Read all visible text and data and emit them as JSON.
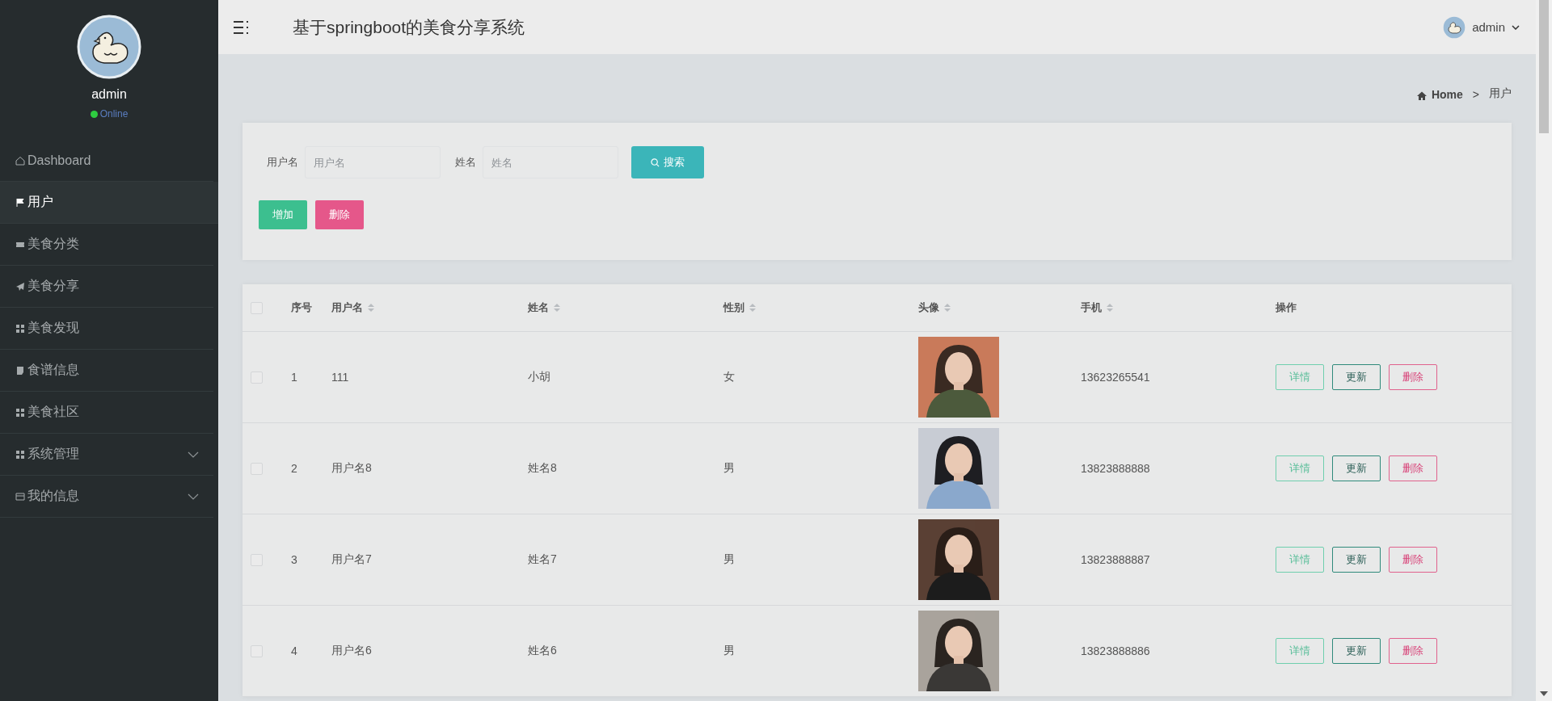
{
  "sidebar": {
    "user": {
      "name": "admin",
      "status": "Online",
      "online": true
    },
    "items": [
      {
        "label": "Dashboard",
        "kind": "link",
        "selected": false
      },
      {
        "label": "用户",
        "kind": "link",
        "selected": true
      },
      {
        "label": "美食分类",
        "kind": "link",
        "selected": false
      },
      {
        "label": "美食分享",
        "kind": "link",
        "selected": false
      },
      {
        "label": "美食发现",
        "kind": "link",
        "selected": false
      },
      {
        "label": "食谱信息",
        "kind": "link",
        "selected": false
      },
      {
        "label": "美食社区",
        "kind": "link",
        "selected": false
      },
      {
        "label": "系统管理",
        "kind": "group",
        "selected": false
      },
      {
        "label": "我的信息",
        "kind": "group",
        "selected": false
      }
    ]
  },
  "header": {
    "title": "基于springboot的美食分享系统",
    "user": "admin"
  },
  "breadcrumb": [
    "Home",
    ">",
    "用户"
  ],
  "search": {
    "fields": [
      {
        "label": "用户名",
        "placeholder": "用户名"
      },
      {
        "label": "姓名",
        "placeholder": "姓名"
      }
    ],
    "button": "搜索"
  },
  "actions": [
    {
      "label": "增加",
      "kind": "add"
    },
    {
      "label": "删除",
      "kind": "delete"
    }
  ],
  "table": {
    "select_all": {
      "checked": false
    },
    "columns": [
      {
        "label": "序号",
        "sortable": false
      },
      {
        "label": "用户名",
        "sortable": true
      },
      {
        "label": "姓名",
        "sortable": true
      },
      {
        "label": "性别",
        "sortable": true
      },
      {
        "label": "头像",
        "sortable": true
      },
      {
        "label": "手机",
        "sortable": true
      },
      {
        "label": "操作",
        "sortable": false
      }
    ],
    "rows": [
      {
        "checked": false,
        "index": "1",
        "username": "111",
        "name": "小胡",
        "gender": "女",
        "avatar": {
          "kind": "picture"
        },
        "phone": "13623265541",
        "buttons": [
          {
            "label": "详情",
            "kind": "detail"
          },
          {
            "label": "更新",
            "kind": "update"
          },
          {
            "label": "删除",
            "kind": "delete"
          }
        ]
      },
      {
        "checked": false,
        "index": "2",
        "username": "用户名8",
        "name": "姓名8",
        "gender": "男",
        "avatar": {
          "kind": "picture"
        },
        "phone": "13823888888",
        "buttons": [
          {
            "label": "详情",
            "kind": "detail"
          },
          {
            "label": "更新",
            "kind": "update"
          },
          {
            "label": "删除",
            "kind": "delete"
          }
        ]
      },
      {
        "checked": false,
        "index": "3",
        "username": "用户名7",
        "name": "姓名7",
        "gender": "男",
        "avatar": {
          "kind": "picture"
        },
        "phone": "13823888887",
        "buttons": [
          {
            "label": "详情",
            "kind": "detail"
          },
          {
            "label": "更新",
            "kind": "update"
          },
          {
            "label": "删除",
            "kind": "delete"
          }
        ]
      },
      {
        "checked": false,
        "index": "4",
        "username": "用户名6",
        "name": "姓名6",
        "gender": "男",
        "avatar": {
          "kind": "picture"
        },
        "phone": "13823888886",
        "buttons": [
          {
            "label": "详情",
            "kind": "detail"
          },
          {
            "label": "更新",
            "kind": "update"
          },
          {
            "label": "删除",
            "kind": "delete"
          }
        ]
      }
    ]
  }
}
